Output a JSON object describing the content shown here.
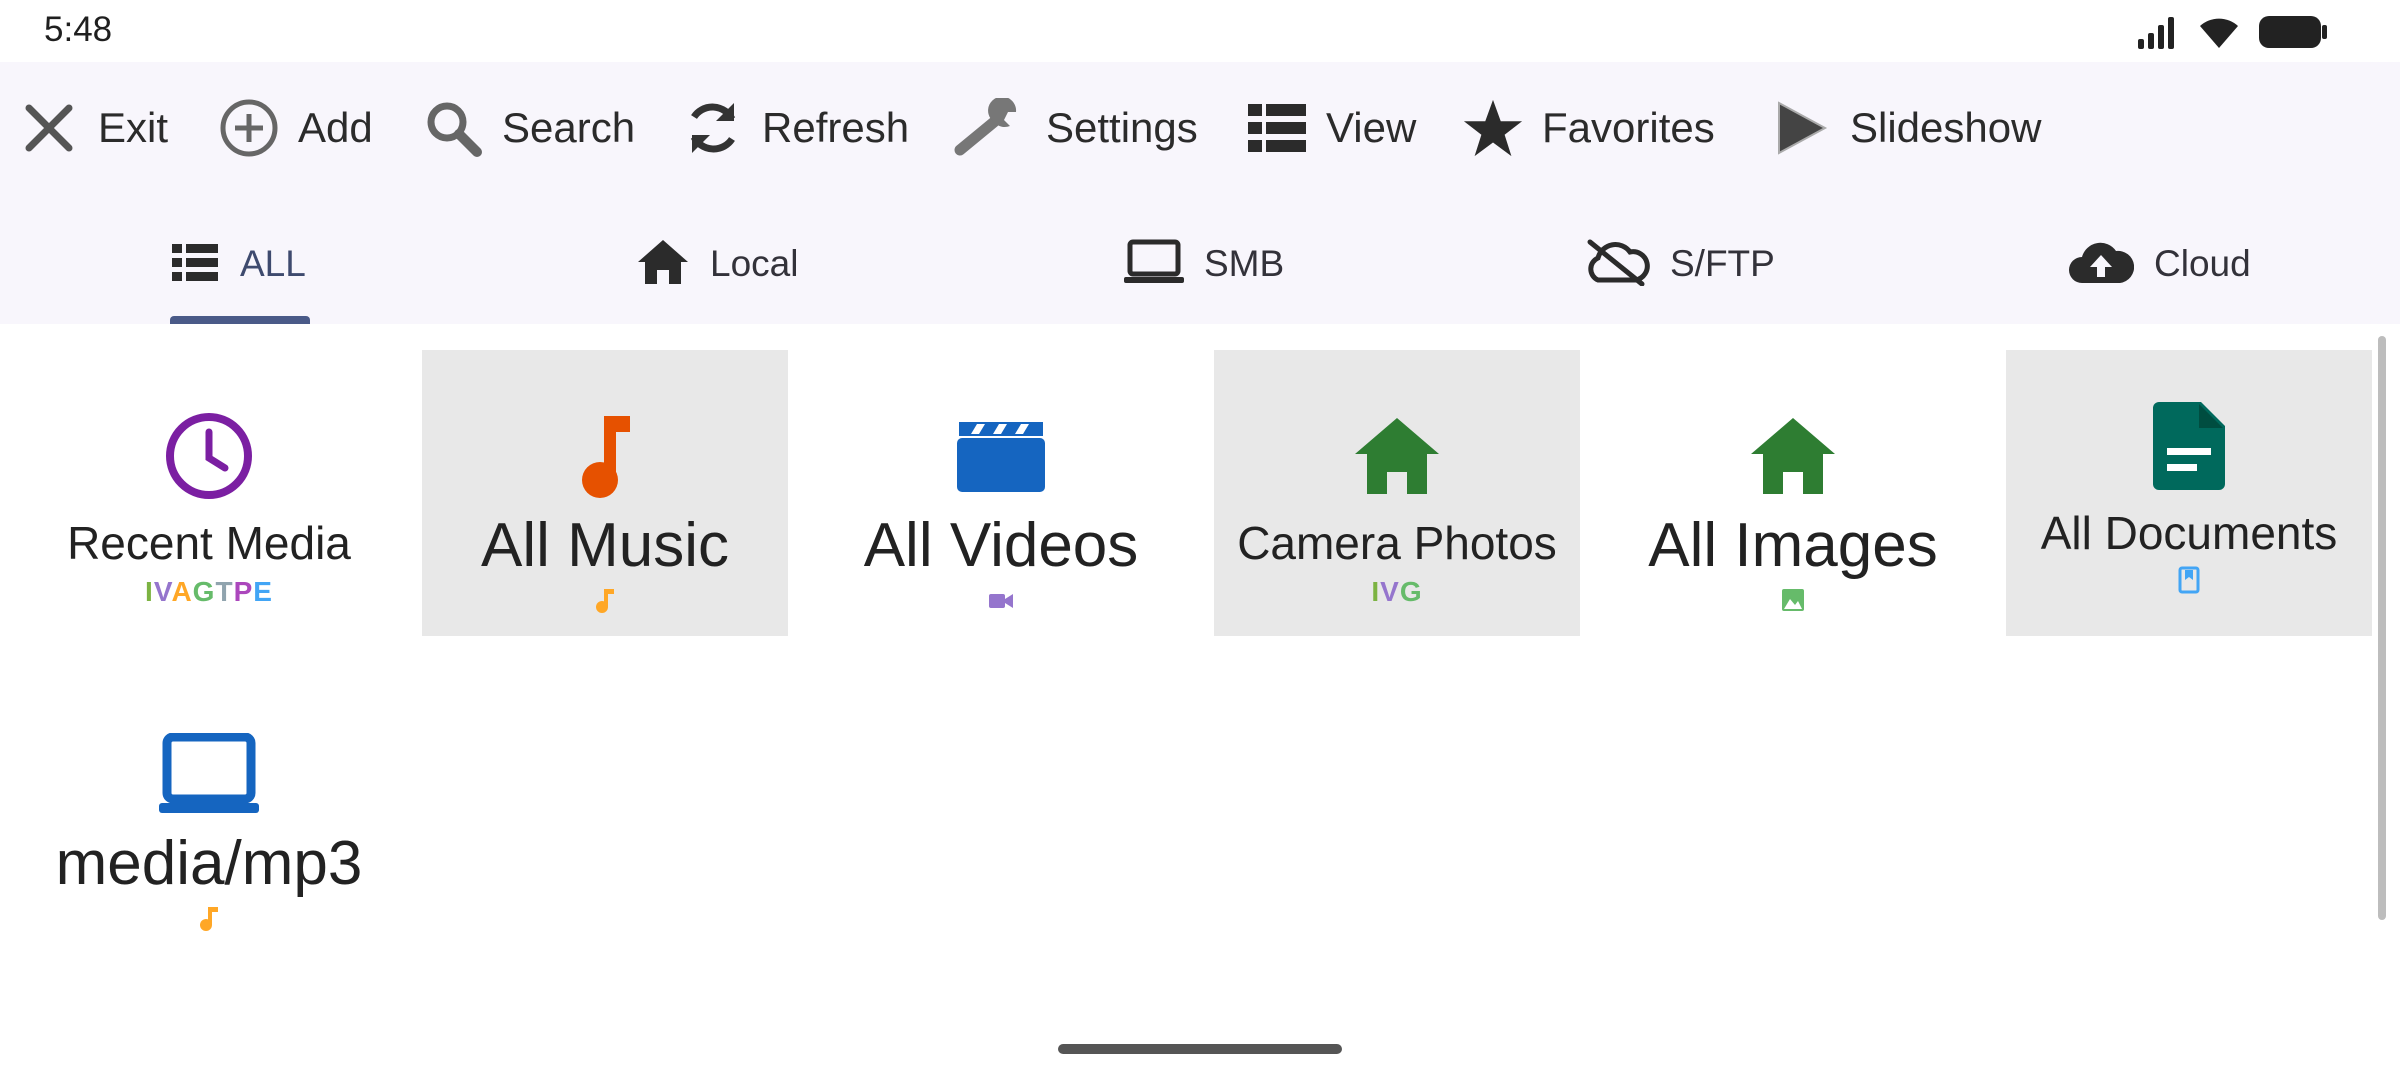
{
  "status": {
    "time": "5:48"
  },
  "toolbar": {
    "items": [
      {
        "label": "Exit",
        "icon": "close-icon"
      },
      {
        "label": "Add",
        "icon": "add-circle-icon"
      },
      {
        "label": "Search",
        "icon": "search-icon"
      },
      {
        "label": "Refresh",
        "icon": "refresh-icon"
      },
      {
        "label": "Settings",
        "icon": "wrench-icon"
      },
      {
        "label": "View",
        "icon": "list-view-icon"
      },
      {
        "label": "Favorites",
        "icon": "star-icon"
      },
      {
        "label": "Slideshow",
        "icon": "play-icon"
      }
    ]
  },
  "tabs": {
    "active": "ALL",
    "items": [
      {
        "label": "ALL",
        "icon": "list-icon"
      },
      {
        "label": "Local",
        "icon": "home-icon"
      },
      {
        "label": "SMB",
        "icon": "laptop-icon"
      },
      {
        "label": "S/FTP",
        "icon": "cloud-off-icon"
      },
      {
        "label": "Cloud",
        "icon": "cloud-upload-icon"
      }
    ]
  },
  "grid": {
    "tiles": [
      {
        "name": "Recent Media",
        "sub": "IVAGTPE",
        "icon": "clock-icon",
        "color": "#7b1fa2"
      },
      {
        "name": "All Music",
        "sub": "",
        "icon": "music-note-icon",
        "color": "#e65100"
      },
      {
        "name": "All Videos",
        "sub": "",
        "icon": "movie-icon",
        "color": "#1565c0"
      },
      {
        "name": "Camera Photos",
        "sub": "IVG",
        "icon": "home-icon",
        "color": "#2e7d32"
      },
      {
        "name": "All Images",
        "sub": "",
        "icon": "home-icon",
        "color": "#2e7d32"
      },
      {
        "name": "All Documents",
        "sub": "",
        "icon": "document-icon",
        "color": "#00695c"
      },
      {
        "name": "media/mp3",
        "sub": "",
        "icon": "laptop-icon",
        "color": "#1565c0"
      }
    ]
  }
}
